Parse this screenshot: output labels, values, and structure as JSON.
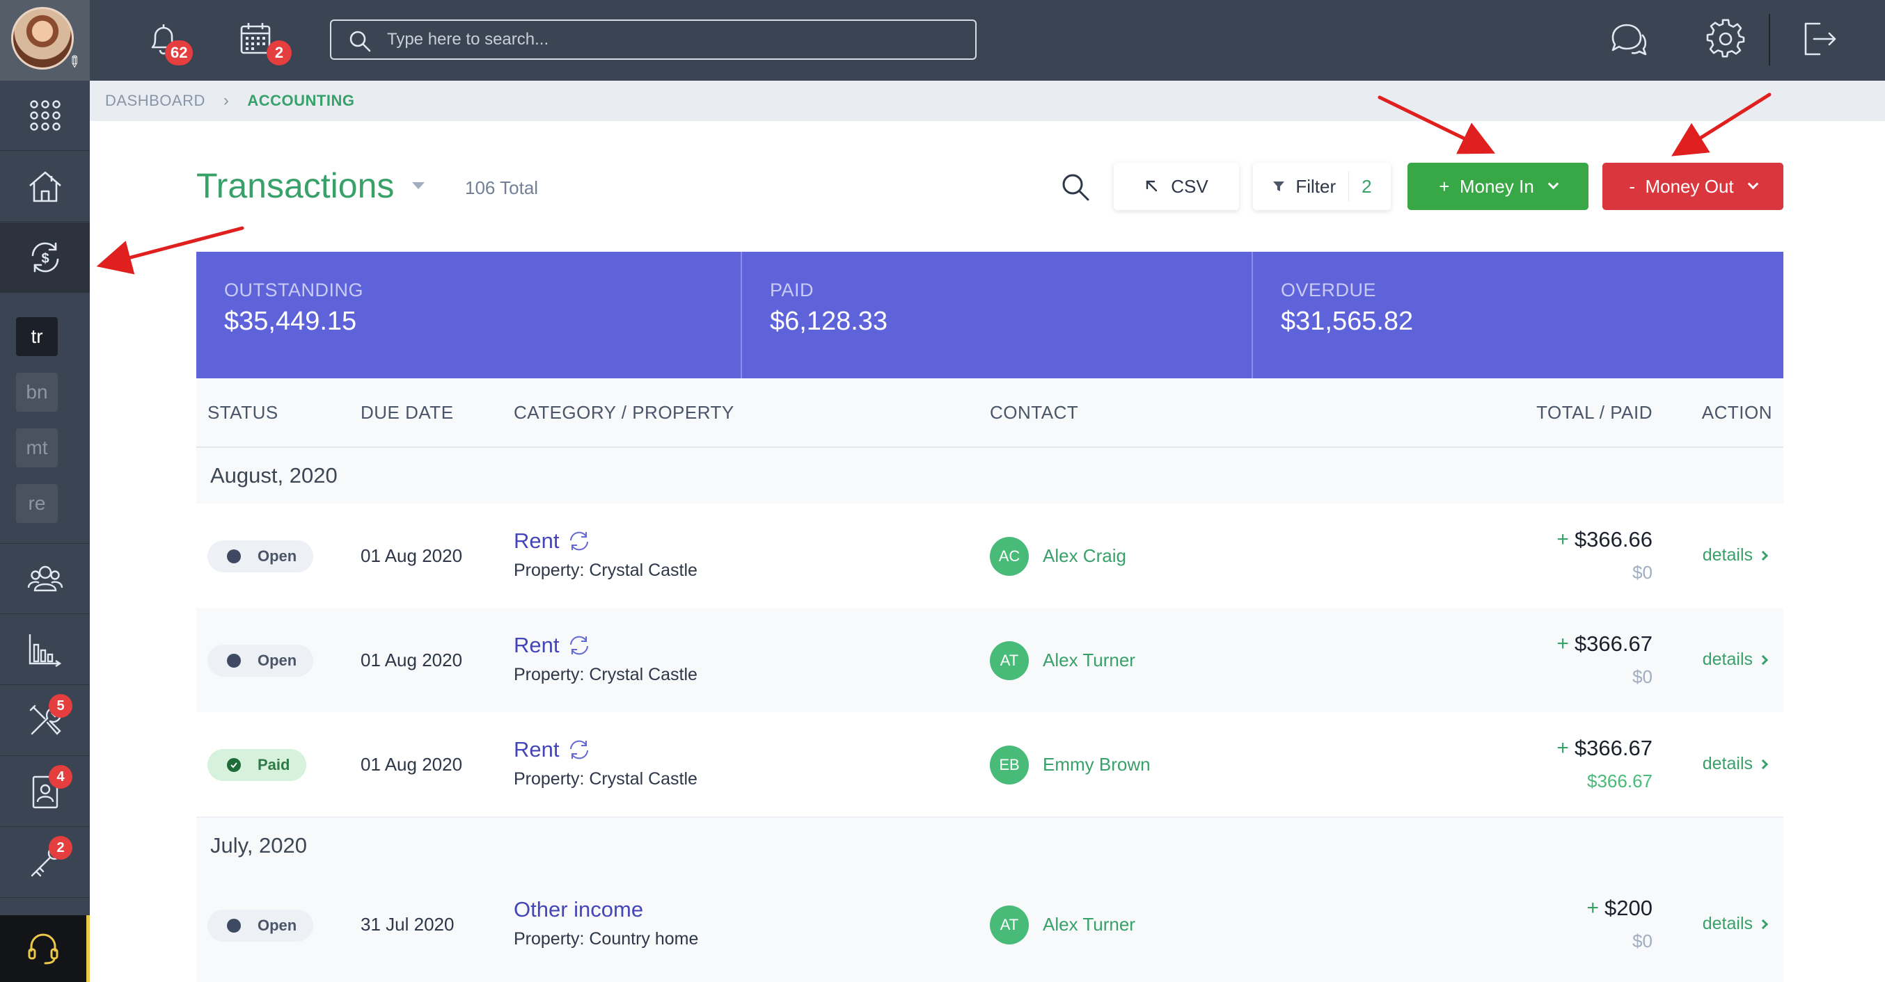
{
  "topbar": {
    "notifications_count": "62",
    "calendar_count": "2",
    "search_placeholder": "Type here to search..."
  },
  "sidebar": {
    "sub_items": [
      "tr",
      "bn",
      "mt",
      "re"
    ],
    "badges": {
      "maintenance": "5",
      "tenants": "4",
      "tools": "2"
    }
  },
  "breadcrumb": {
    "root": "DASHBOARD",
    "current": "ACCOUNTING"
  },
  "header": {
    "title": "Transactions",
    "total": "106 Total",
    "csv_label": "CSV",
    "filter_label": "Filter",
    "filter_count": "2",
    "money_in_label": "+  Money In",
    "money_out_label": "-  Money Out"
  },
  "summary": {
    "outstanding_label": "OUTSTANDING",
    "outstanding_value": "$35,449.15",
    "paid_label": "PAID",
    "paid_value": "$6,128.33",
    "overdue_label": "OVERDUE",
    "overdue_value": "$31,565.82"
  },
  "table": {
    "columns": [
      "STATUS",
      "DUE DATE",
      "CATEGORY / PROPERTY",
      "CONTACT",
      "TOTAL / PAID",
      "ACTION"
    ],
    "groups": [
      {
        "label": "August, 2020"
      },
      {
        "label": "July, 2020"
      }
    ],
    "rows": [
      {
        "status": "Open",
        "date": "01 Aug 2020",
        "category": "Rent",
        "property": "Property: Crystal Castle",
        "initials": "AC",
        "contact": "Alex Craig",
        "total": "$366.66",
        "paid": "$0",
        "action": "details"
      },
      {
        "status": "Open",
        "date": "01 Aug 2020",
        "category": "Rent",
        "property": "Property: Crystal Castle",
        "initials": "AT",
        "contact": "Alex Turner",
        "total": "$366.67",
        "paid": "$0",
        "action": "details"
      },
      {
        "status": "Paid",
        "date": "01 Aug 2020",
        "category": "Rent",
        "property": "Property: Crystal Castle",
        "initials": "EB",
        "contact": "Emmy Brown",
        "total": "$366.67",
        "paid": "$366.67",
        "action": "details"
      },
      {
        "status": "Open",
        "date": "31 Jul 2020",
        "category": "Other income",
        "property": "Property: Country home",
        "initials": "AT",
        "contact": "Alex Turner",
        "total": "$200",
        "paid": "$0",
        "action": "details"
      }
    ]
  },
  "colors": {
    "accent_green": "#38a169",
    "money_in": "#38a745",
    "money_out": "#d9363e",
    "summary_bg": "#5f63d9",
    "sidebar_bg": "#3b4452",
    "annotation_arrow": "#e0201f"
  },
  "icons": [
    "bell-icon",
    "calendar-icon",
    "search-icon",
    "chat-icon",
    "gear-icon",
    "logout-icon",
    "apps-grid-icon",
    "house-icon",
    "money-cycle-icon",
    "people-icon",
    "chart-icon",
    "tools-icon",
    "tenant-file-icon",
    "key-icon",
    "headset-icon",
    "recurring-icon"
  ]
}
